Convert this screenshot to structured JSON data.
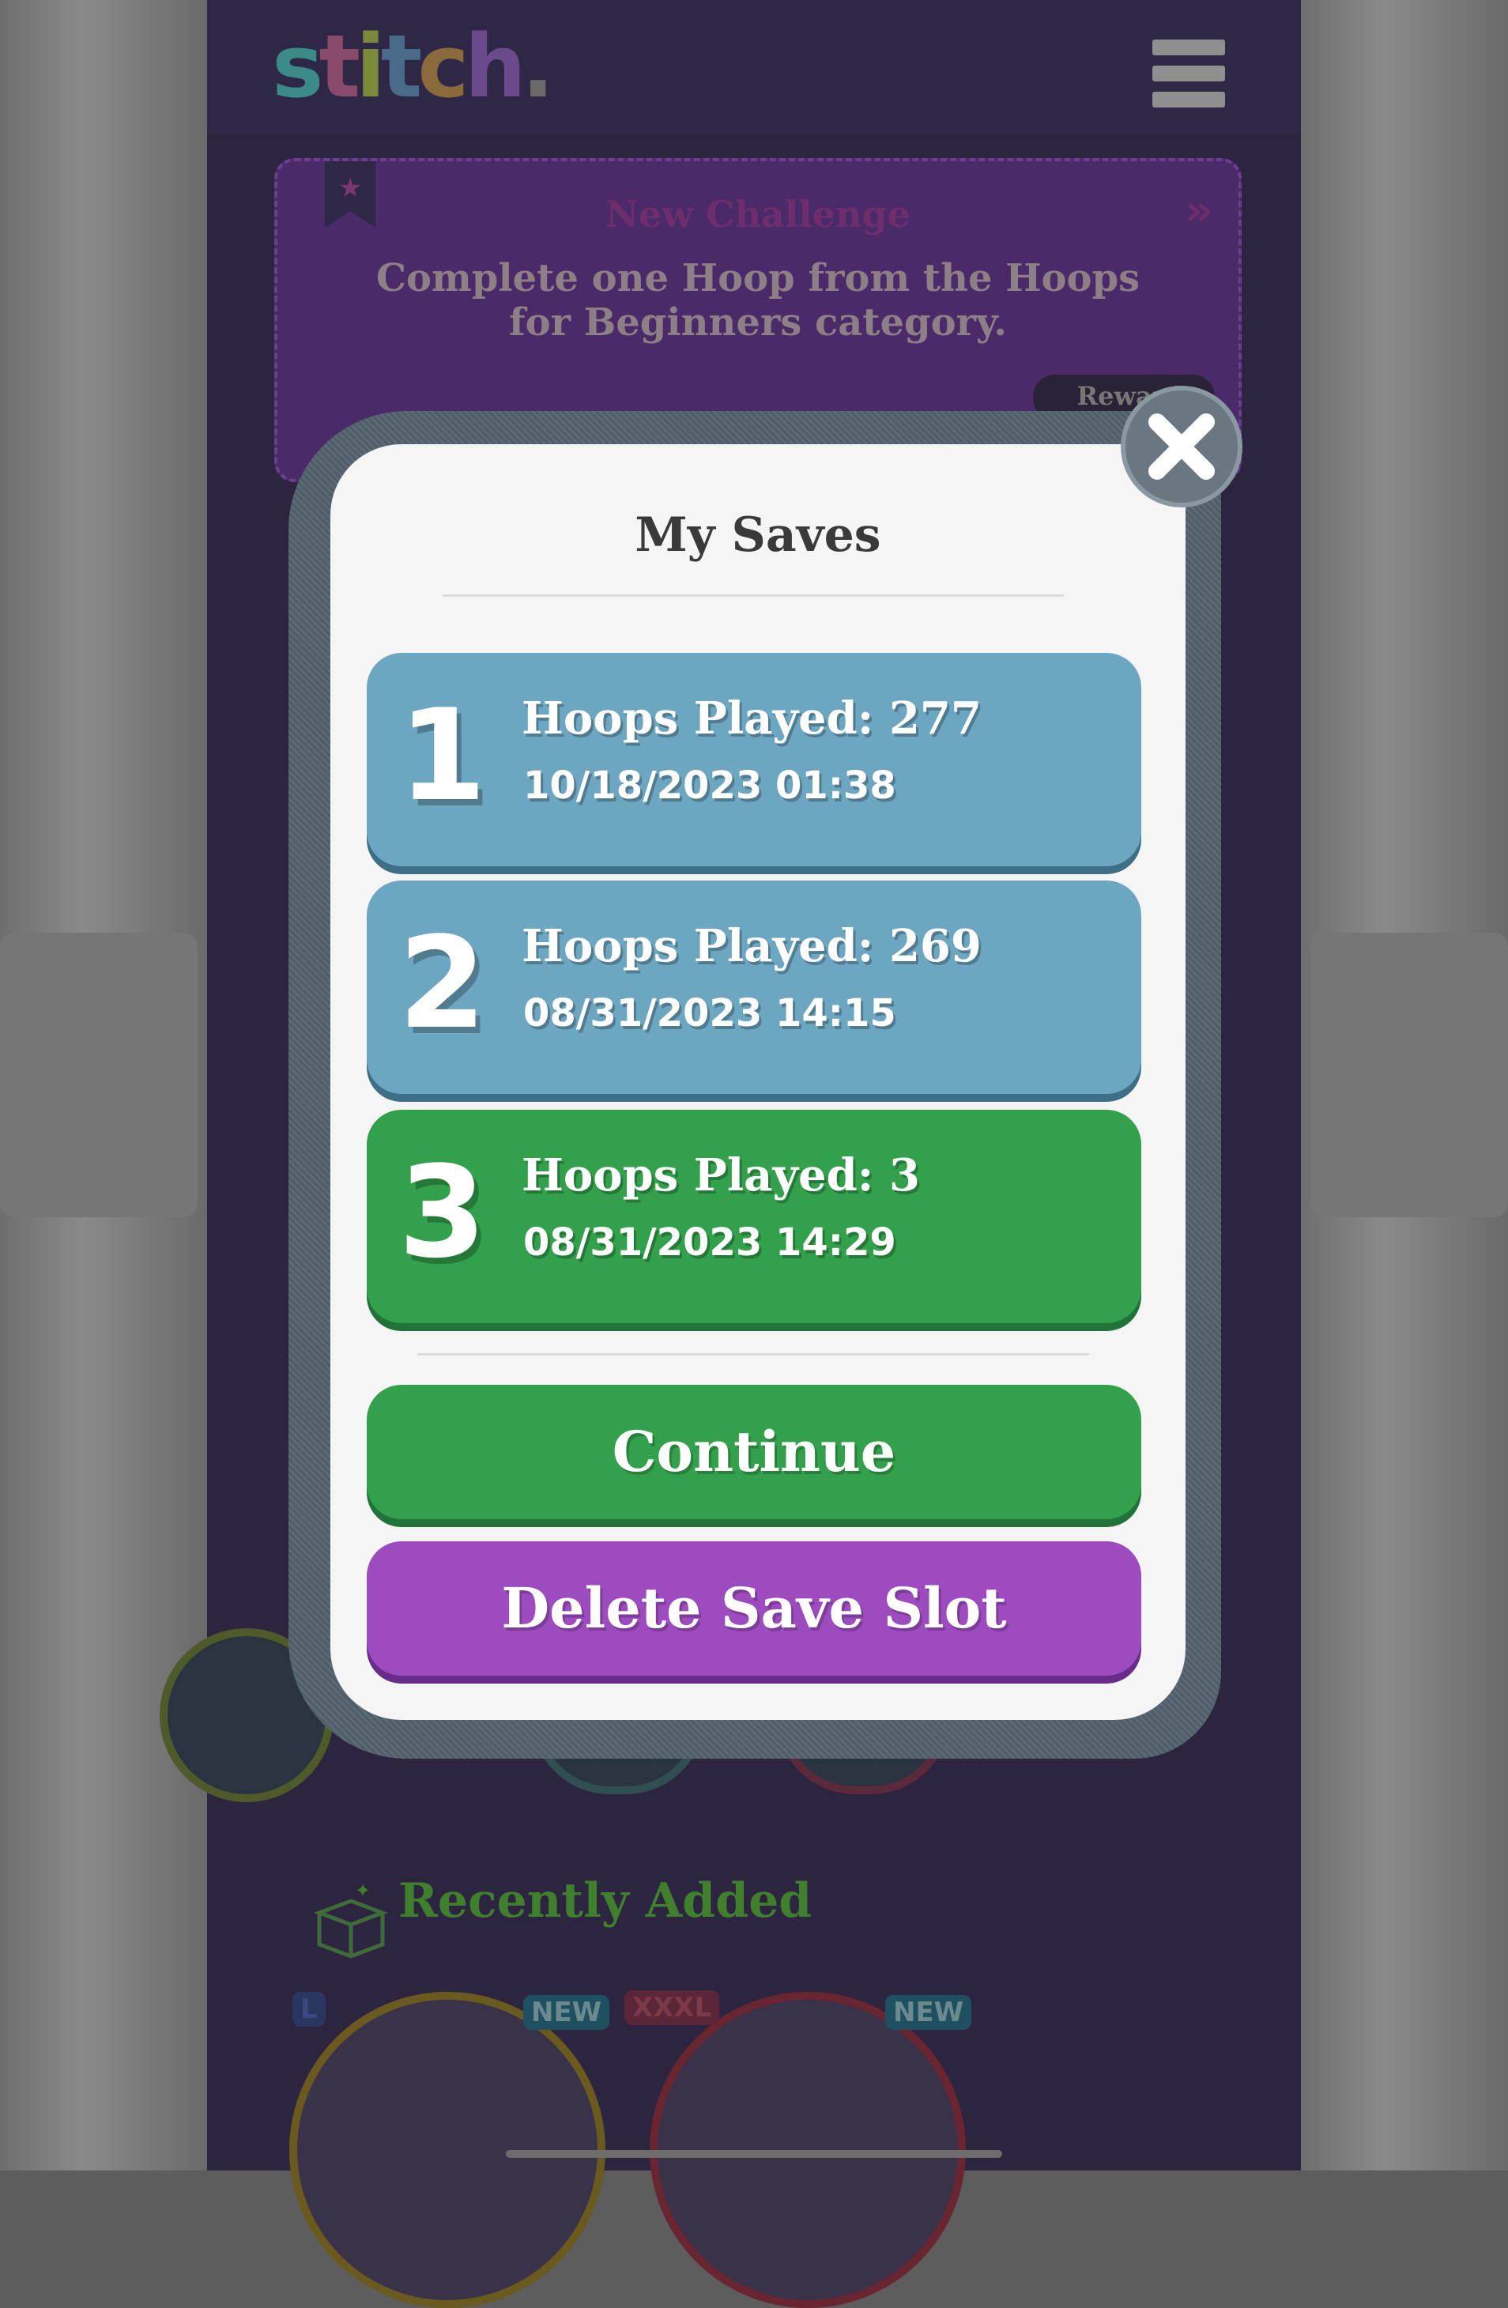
{
  "app": {
    "logo_text": "stitch."
  },
  "challenge": {
    "title": "New Challenge",
    "description": "Complete one Hoop from the Hoops for Beginners category.",
    "reward_label": "Reward"
  },
  "modal": {
    "title": "My Saves",
    "slots": [
      {
        "number": "1",
        "hoops": "Hoops Played: 277",
        "date": "10/18/2023 01:38",
        "color": "#6da6c0"
      },
      {
        "number": "2",
        "hoops": "Hoops Played: 269",
        "date": "08/31/2023 14:15",
        "color": "#6da6c0"
      },
      {
        "number": "3",
        "hoops": "Hoops Played: 3",
        "date": "08/31/2023 14:29",
        "color": "#33a14c"
      }
    ],
    "continue_label": "Continue",
    "delete_label": "Delete Save Slot"
  },
  "recent": {
    "title": "Recently Added",
    "items": [
      {
        "size_badge": "L",
        "new_badge": "NEW"
      },
      {
        "size_badge": "XXXL",
        "new_badge": "NEW"
      }
    ]
  },
  "colors": {
    "slot_blue": "#6da6c0",
    "slot_green": "#33a14c",
    "continue_green": "#33a14c",
    "delete_purple": "#9d4cbf"
  }
}
